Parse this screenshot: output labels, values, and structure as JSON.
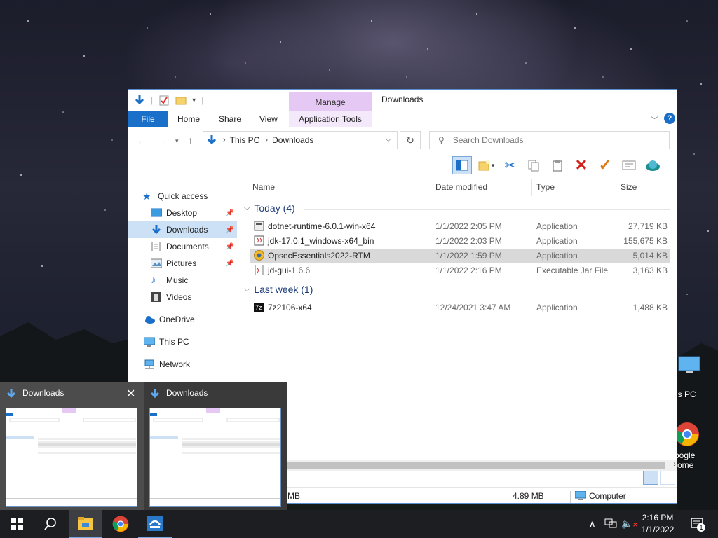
{
  "desktop": {
    "this_pc_label": "is PC",
    "chrome_label_1": "oogle",
    "chrome_label_2": "rome"
  },
  "explorer": {
    "manage_tab": "Manage",
    "window_title": "Downloads",
    "tabs": {
      "file": "File",
      "home": "Home",
      "share": "Share",
      "view": "View",
      "app_tools": "Application Tools"
    },
    "help": "?",
    "address": {
      "segments": [
        "This PC",
        "Downloads"
      ]
    },
    "search_placeholder": "Search Downloads",
    "sidebar": {
      "quick_access": "Quick access",
      "items": [
        "Desktop",
        "Downloads",
        "Documents",
        "Pictures",
        "Music",
        "Videos"
      ],
      "onedrive": "OneDrive",
      "this_pc": "This PC",
      "network": "Network"
    },
    "columns": {
      "name": "Name",
      "date": "Date modified",
      "type": "Type",
      "size": "Size"
    },
    "groups": [
      {
        "label": "Today (4)",
        "files": [
          {
            "name": "dotnet-runtime-6.0.1-win-x64",
            "date": "1/1/2022 2:05 PM",
            "type": "Application",
            "size": "27,719 KB"
          },
          {
            "name": "jdk-17.0.1_windows-x64_bin",
            "date": "1/1/2022 2:03 PM",
            "type": "Application",
            "size": "155,675 KB"
          },
          {
            "name": "OpsecEssentials2022-RTM",
            "date": "1/1/2022 1:59 PM",
            "type": "Application",
            "size": "5,014 KB"
          },
          {
            "name": "jd-gui-1.6.6",
            "date": "1/1/2022 2:16 PM",
            "type": "Executable Jar File",
            "size": "3,163 KB"
          }
        ]
      },
      {
        "label": "Last week (1)",
        "files": [
          {
            "name": "7z2106-x64",
            "date": "12/24/2021 3:47 AM",
            "type": "Application",
            "size": "1,488 KB"
          }
        ]
      }
    ],
    "status": {
      "left_fragment": "MB",
      "size": "4.89 MB",
      "location": "Computer"
    }
  },
  "thumbnails": [
    {
      "title": "Downloads",
      "close": "✕"
    },
    {
      "title": "Downloads"
    }
  ],
  "taskbar": {
    "time": "2:16 PM",
    "date": "1/1/2022",
    "notifications": "1"
  },
  "colors": {
    "accent": "#1a6fc9",
    "manage_tab": "#e6c8f5",
    "selection": "#cce1f6"
  },
  "icons": [
    "windows-start-icon",
    "search-icon",
    "file-explorer-icon",
    "chrome-icon",
    "installer-icon",
    "chevron-up-icon",
    "network-icon",
    "speaker-muted-icon",
    "notification-icon"
  ]
}
